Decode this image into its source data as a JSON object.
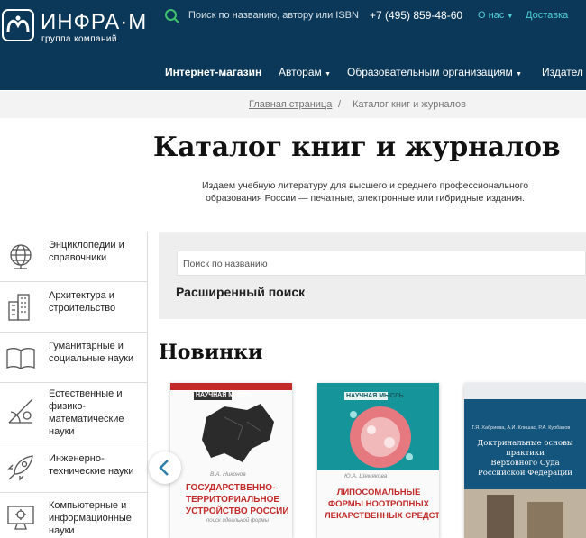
{
  "header": {
    "logo_name": "ИНФРА·М",
    "logo_sub": "группа компаний",
    "search_placeholder": "Поиск по названию, автору или ISBN",
    "phone": "+7 (495) 859-48-60",
    "about": "О нас",
    "delivery": "Доставка",
    "nav": [
      "Интернет-магазин",
      "Авторам",
      "Образовательным организациям",
      "Издател"
    ]
  },
  "breadcrumbs": {
    "home": "Главная страница",
    "sep": "/",
    "current": "Каталог книг и журналов"
  },
  "page": {
    "title": "Каталог книг и журналов",
    "intro_1": "Издаем учебную литературу для высшего и среднего профессионального",
    "intro_2": "образования России — печатные, электронные или гибридные издания."
  },
  "categories": [
    {
      "label": "Энциклопедии и\nсправочники",
      "icon": "globe-icon"
    },
    {
      "label": "Архитектура и\nстроительство",
      "icon": "buildings-icon"
    },
    {
      "label": "Гуманитарные и\nсоциальные науки",
      "icon": "book-icon"
    },
    {
      "label": "Естественные и\nфизико-\nматематические\nнауки",
      "icon": "geometry-icon"
    },
    {
      "label": "Инженерно-\nтехнические науки",
      "icon": "rocket-icon"
    },
    {
      "label": "Компьютерные и\nинформационные\nнауки",
      "icon": "monitor-icon"
    }
  ],
  "search": {
    "placeholder": "Поиск по названию",
    "advanced": "Расширенный поиск"
  },
  "new": {
    "heading": "Новинки"
  },
  "books": [
    {
      "series": "НАУЧНАЯ МЫСЛЬ",
      "author": "В.А. Никонов",
      "title": [
        "ГОСУДАРСТВЕННО-",
        "ТЕРРИТОРИАЛЬНОЕ",
        "УСТРОЙСТВО РОССИИ"
      ],
      "subtitle": "поиск идеальной формы"
    },
    {
      "series": "НАУЧНАЯ МЫСЛЬ",
      "author": "Ю.А. Шемякова",
      "title": [
        "ЛИПОСОМАЛЬНЫЕ",
        "ФОРМЫ НООТРОПНЫХ",
        "ЛЕКАРСТВЕННЫХ СРЕДСТВ"
      ]
    },
    {
      "authors": "Т.Я. Хабриева, А.И. Клишас, Р.А. Курбанов",
      "title": [
        "Доктринальные основы",
        "практики",
        "Верховного Суда",
        "Российской Федерации"
      ]
    }
  ],
  "colors": {
    "header_bg": "#0b3858",
    "accent": "#2cb6c0",
    "book2_bg": "#15959a",
    "book3_bg": "#14557d"
  }
}
